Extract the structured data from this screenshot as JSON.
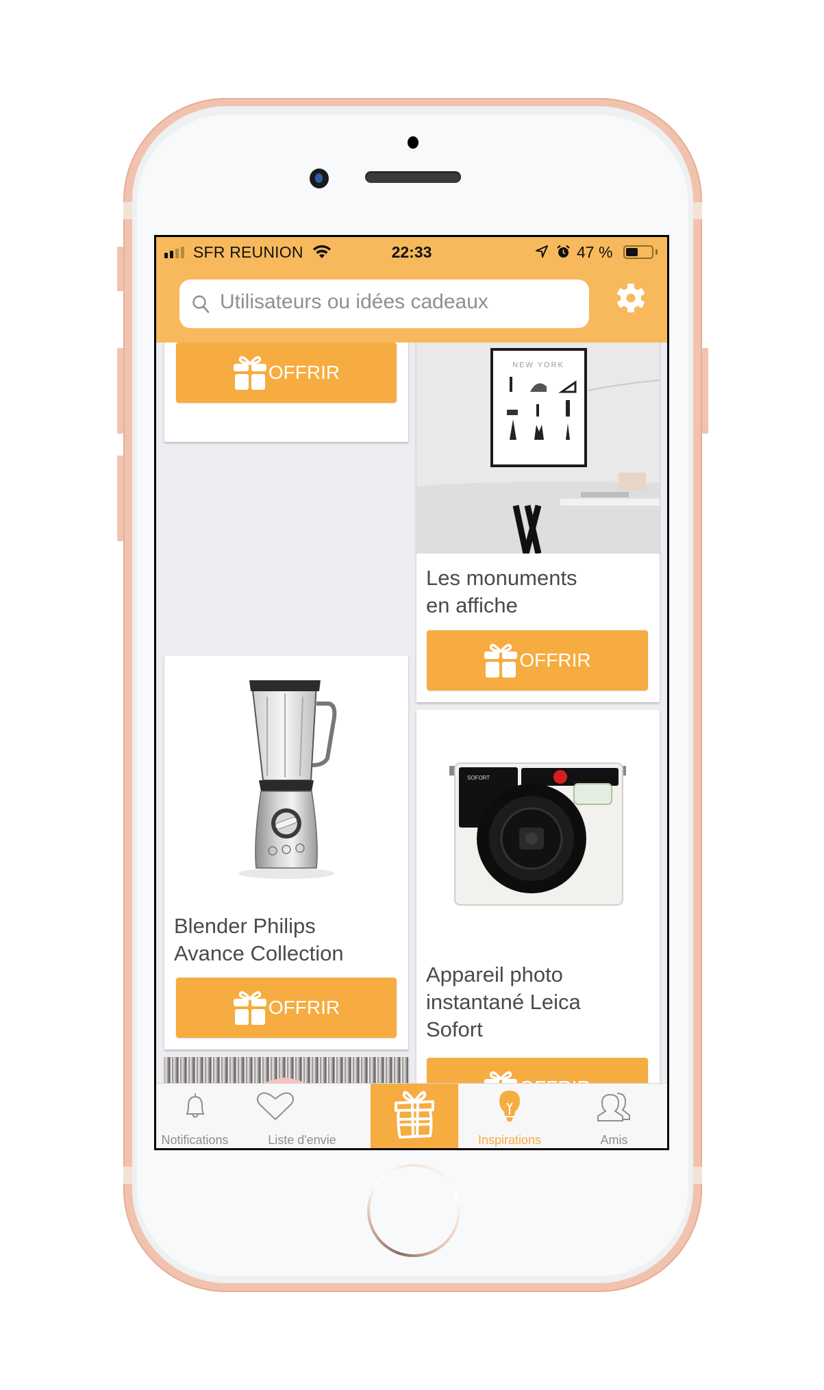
{
  "status_bar": {
    "carrier": "SFR REUNION",
    "time": "22:33",
    "battery_percent_label": "47 %",
    "battery_level": 0.47,
    "signal_bars_active": 2,
    "signal_bars_total": 4
  },
  "header": {
    "search_placeholder": "Utilisateurs ou idées cadeaux",
    "search_icon": "search-icon",
    "settings_icon": "gear-icon"
  },
  "feed": {
    "offer_label": "OFFRIR",
    "items": [
      {
        "title": "",
        "image": "hidden-above",
        "column": "left"
      },
      {
        "title": "Blender Philips Avance Collection",
        "title_lines": [
          "Blender Philips",
          "Avance Collection"
        ],
        "image": "blender",
        "column": "left"
      },
      {
        "title": "",
        "image": "pink-bathrobe-photo",
        "column": "left"
      },
      {
        "title": "Les monuments en affiche",
        "title_lines": [
          "Les monuments",
          "en affiche"
        ],
        "image": "new-york-poster",
        "poster_caption": "NEW YORK",
        "column": "right"
      },
      {
        "title": "Appareil photo instantané Leica Sofort",
        "title_lines": [
          "Appareil photo",
          "instantané Leica",
          "Sofort"
        ],
        "image": "leica-sofort-camera",
        "column": "right"
      }
    ]
  },
  "tab_bar": {
    "tabs": [
      {
        "label": "Notifications",
        "icon": "bell-icon",
        "active": false
      },
      {
        "label": "Liste d'envie",
        "icon": "heart-icon",
        "active": false
      },
      {
        "label": "",
        "icon": "gift-icon",
        "active": false,
        "highlighted": true
      },
      {
        "label": "Inspirations",
        "icon": "lightbulb-icon",
        "active": true
      },
      {
        "label": "Amis",
        "icon": "friends-icon",
        "active": false
      }
    ]
  },
  "colors": {
    "header": "#F7B95B",
    "accent": "#F6AC40",
    "text": "#4A4A4A",
    "tab_inactive": "#8E8E93",
    "background": "#ECECF1",
    "phone_frame": "#F1C3AE"
  }
}
